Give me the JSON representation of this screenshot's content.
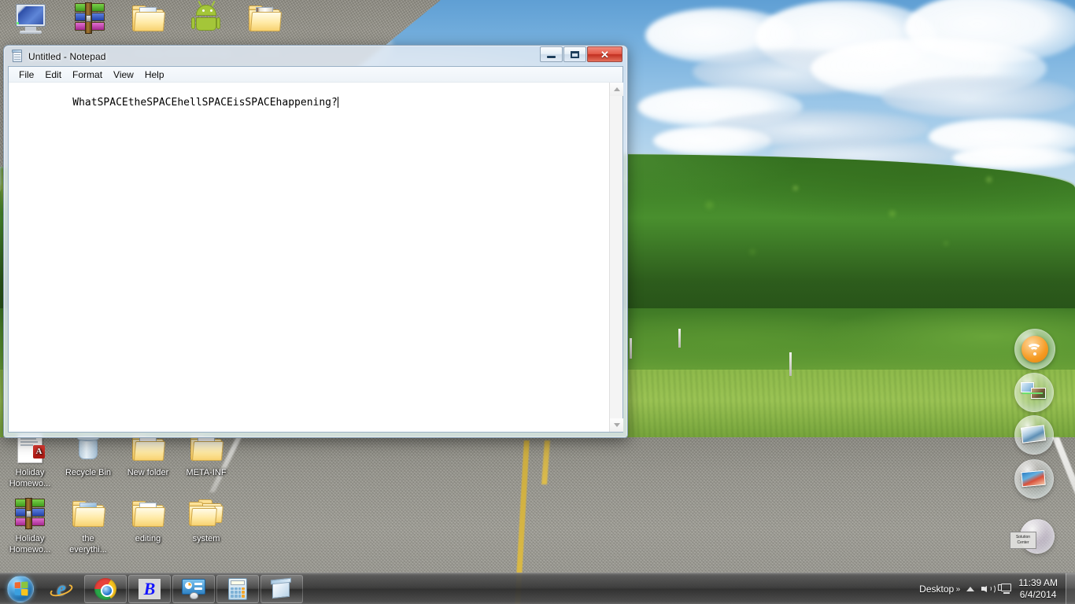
{
  "window": {
    "title": "Untitled - Notepad",
    "app_icon": "notepad-icon",
    "menus": [
      "File",
      "Edit",
      "Format",
      "View",
      "Help"
    ],
    "controls": {
      "minimize": "minimize-button",
      "maximize": "maximize-button",
      "close": "close-button",
      "close_glyph": "✕"
    },
    "document_text": "WhatSPACEtheSPACEhellSPACEisSPACEhappening?"
  },
  "desktop": {
    "icons_top": [
      {
        "label": "",
        "icon": "computer-icon"
      },
      {
        "label": "",
        "icon": "winrar-archive-icon"
      },
      {
        "label": "",
        "icon": "folder-icon"
      },
      {
        "label": "",
        "icon": "android-icon"
      },
      {
        "label": "",
        "icon": "folder-book-icon"
      }
    ],
    "icons_row1": [
      {
        "label": "Holiday\nHomewo...",
        "icon": "pdf-document-icon"
      },
      {
        "label": "Recycle Bin",
        "icon": "recycle-bin-icon"
      },
      {
        "label": "New folder",
        "icon": "folder-icon"
      },
      {
        "label": "META-INF",
        "icon": "folder-icon"
      }
    ],
    "icons_row2": [
      {
        "label": "Holiday\nHomewo...",
        "icon": "winrar-archive-icon"
      },
      {
        "label": "the\neverythi...",
        "icon": "folder-icon"
      },
      {
        "label": "editing",
        "icon": "folder-icon"
      },
      {
        "label": "system",
        "icon": "multi-folder-icon"
      }
    ],
    "gadgets": [
      {
        "name": "wireless-bubble",
        "icon": "wifi-icon"
      },
      {
        "name": "scan-bubble",
        "icon": "scan-photo-icon"
      },
      {
        "name": "print-bubble",
        "icon": "print-photo-icon"
      },
      {
        "name": "photo-bubble",
        "icon": "photo-icon"
      },
      {
        "name": "solution-center-bubble",
        "icon": "solution-center-icon",
        "label": "Solution\nCenter"
      }
    ]
  },
  "taskbar": {
    "start": {
      "name": "start-button",
      "icon": "windows-logo-icon"
    },
    "buttons": [
      {
        "name": "internet-explorer",
        "icon": "internet-explorer-icon"
      },
      {
        "name": "google-chrome",
        "icon": "chrome-icon"
      },
      {
        "name": "bluestacks",
        "icon": "b-icon"
      },
      {
        "name": "control-panel",
        "icon": "control-panel-icon"
      },
      {
        "name": "calculator",
        "icon": "calculator-icon"
      },
      {
        "name": "notepad",
        "icon": "notepad-icon"
      }
    ],
    "tray": {
      "desktop_label": "Desktop",
      "chevrons": "»",
      "show_hidden_icons": "show-hidden-icons-arrow",
      "volume": "volume-icon",
      "network": "network-icon",
      "time": "11:39 AM",
      "date": "6/4/2014"
    }
  },
  "colors": {
    "taskbar": "#3a3a3a",
    "close_button": "#c22f20",
    "window_chrome": "#dee8f2",
    "accent_blue": "#1d6fae",
    "folder_yellow": "#f5c759",
    "android_green": "#a4c639"
  }
}
